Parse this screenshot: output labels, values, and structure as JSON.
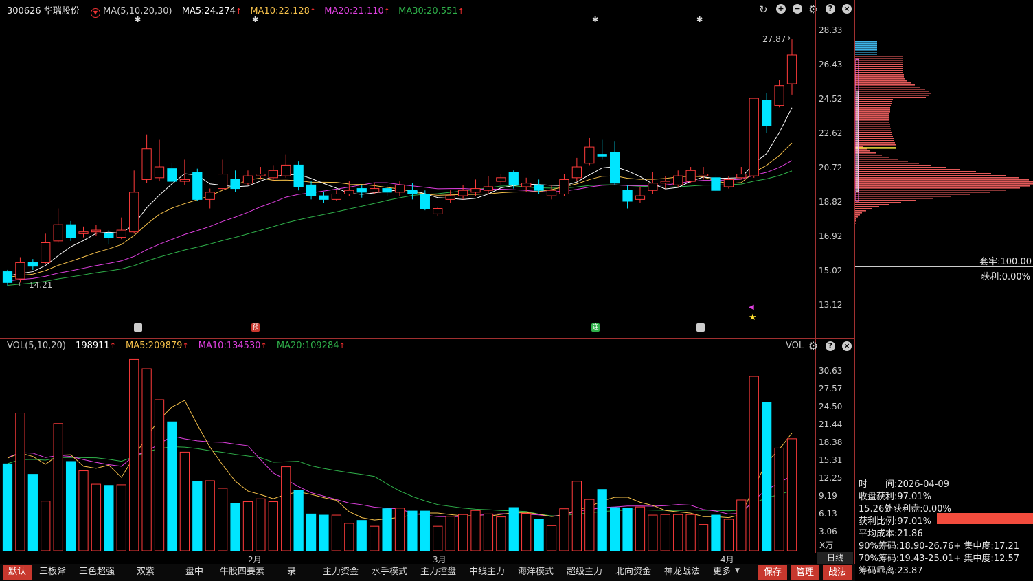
{
  "header": {
    "stock": "300626 华瑞股份",
    "ma_label": "MA(5,10,20,30)",
    "ma5": "MA5:24.274",
    "ma10": "MA10:22.128",
    "ma20": "MA20:21.110",
    "ma30": "MA30:20.551",
    "arrow": "↑"
  },
  "vol_header": {
    "label": "VOL(5,10,20)",
    "vol": "198911",
    "ma5": "MA5:209879",
    "ma10": "MA10:134530",
    "ma20": "MA20:109284",
    "right_label": "VOL",
    "arrow": "↑"
  },
  "price_axis": [
    "28.33",
    "26.43",
    "24.52",
    "22.62",
    "20.72",
    "18.82",
    "16.92",
    "15.02",
    "13.12"
  ],
  "vol_axis": [
    "30.63",
    "27.57",
    "24.50",
    "21.44",
    "18.38",
    "15.31",
    "12.25",
    "9.19",
    "6.13",
    "3.06"
  ],
  "vol_unit": "X万",
  "annotations": {
    "high": "27.87",
    "low": "14.21"
  },
  "x_labels": [
    "2月",
    "3月",
    "4月"
  ],
  "period": "日线",
  "chip_panel": {
    "trapped": "套牢:100.00",
    "profit": "获利:0.00%",
    "time": "时　　间:2026-04-09",
    "close_profit": "收盘获利:97.01%",
    "profit_at": "15.26处获利盘:0.00%",
    "profit_ratio": "获利比例:97.01%",
    "avg_cost": "平均成本:21.86",
    "chip90": "90%筹码:18.90-26.76+ 集中度:17.21",
    "chip70": "70%筹码:19.43-25.01+ 集中度:12.57",
    "deviation": "筹码乖离:23.87"
  },
  "toolbar": {
    "tabs": [
      "默认",
      "三板斧",
      "三色超强",
      "双紫",
      "盘中",
      "牛股四要素",
      "录",
      "主力资金",
      "水手模式",
      "主力控盘",
      "中线主力",
      "海洋模式",
      "超级主力",
      "北向资金",
      "神龙战法",
      "更多"
    ],
    "save": "保存",
    "manage": "管理",
    "battle": "战法"
  },
  "colors": {
    "up": "#ff3b3b",
    "down": "#00e5ff",
    "ma5": "#ffffff",
    "ma10": "#f5c04a",
    "ma20": "#e040e0",
    "ma30": "#2fb04a",
    "accent": "#c8382e"
  },
  "chart_data": {
    "type": "candlestick",
    "price_axis_range": [
      13.12,
      28.33
    ],
    "vol_axis_unit": "万",
    "candles": [
      {
        "o": 15.0,
        "c": 14.4,
        "h": 15.1,
        "l": 14.2
      },
      {
        "o": 14.6,
        "c": 15.5,
        "h": 15.8,
        "l": 14.4
      },
      {
        "o": 15.5,
        "c": 15.3,
        "h": 15.7,
        "l": 15.1
      },
      {
        "o": 15.5,
        "c": 16.6,
        "h": 17.1,
        "l": 15.4
      },
      {
        "o": 16.7,
        "c": 17.6,
        "h": 18.5,
        "l": 16.6
      },
      {
        "o": 17.6,
        "c": 16.9,
        "h": 17.8,
        "l": 16.7
      },
      {
        "o": 17.1,
        "c": 17.2,
        "h": 17.5,
        "l": 16.9
      },
      {
        "o": 17.2,
        "c": 17.3,
        "h": 17.6,
        "l": 17.0
      },
      {
        "o": 17.1,
        "c": 16.9,
        "h": 17.3,
        "l": 16.5
      },
      {
        "o": 16.9,
        "c": 17.3,
        "h": 18.0,
        "l": 16.8
      },
      {
        "o": 17.2,
        "c": 19.4,
        "h": 20.6,
        "l": 17.1
      },
      {
        "o": 20.1,
        "c": 21.8,
        "h": 22.6,
        "l": 19.9
      },
      {
        "o": 20.2,
        "c": 20.8,
        "h": 22.3,
        "l": 20.0
      },
      {
        "o": 20.7,
        "c": 20.0,
        "h": 21.0,
        "l": 19.6
      },
      {
        "o": 20.0,
        "c": 20.1,
        "h": 21.2,
        "l": 19.8
      },
      {
        "o": 20.5,
        "c": 19.0,
        "h": 20.7,
        "l": 18.9
      },
      {
        "o": 19.0,
        "c": 19.4,
        "h": 19.6,
        "l": 18.5
      },
      {
        "o": 19.6,
        "c": 20.4,
        "h": 21.2,
        "l": 19.5
      },
      {
        "o": 20.1,
        "c": 19.6,
        "h": 20.6,
        "l": 19.4
      },
      {
        "o": 19.9,
        "c": 20.3,
        "h": 20.6,
        "l": 19.8
      },
      {
        "o": 20.3,
        "c": 20.4,
        "h": 20.8,
        "l": 20.1
      },
      {
        "o": 20.2,
        "c": 20.6,
        "h": 20.9,
        "l": 20.0
      },
      {
        "o": 20.3,
        "c": 20.9,
        "h": 21.5,
        "l": 20.2
      },
      {
        "o": 20.9,
        "c": 19.7,
        "h": 21.1,
        "l": 19.5
      },
      {
        "o": 19.8,
        "c": 19.2,
        "h": 20.0,
        "l": 19.0
      },
      {
        "o": 19.2,
        "c": 19.0,
        "h": 19.4,
        "l": 18.8
      },
      {
        "o": 19.0,
        "c": 19.3,
        "h": 19.5,
        "l": 18.9
      },
      {
        "o": 19.3,
        "c": 19.5,
        "h": 20.0,
        "l": 19.2
      },
      {
        "o": 19.6,
        "c": 19.4,
        "h": 19.8,
        "l": 19.1
      },
      {
        "o": 19.4,
        "c": 19.6,
        "h": 19.9,
        "l": 19.3
      },
      {
        "o": 19.6,
        "c": 19.4,
        "h": 19.8,
        "l": 19.2
      },
      {
        "o": 19.4,
        "c": 19.8,
        "h": 20.0,
        "l": 19.2
      },
      {
        "o": 19.5,
        "c": 19.3,
        "h": 19.9,
        "l": 19.0
      },
      {
        "o": 19.3,
        "c": 18.5,
        "h": 19.5,
        "l": 18.4
      },
      {
        "o": 18.2,
        "c": 18.5,
        "h": 18.6,
        "l": 18.1
      },
      {
        "o": 19.0,
        "c": 19.2,
        "h": 19.5,
        "l": 18.8
      },
      {
        "o": 19.2,
        "c": 19.5,
        "h": 19.8,
        "l": 19.0
      },
      {
        "o": 19.4,
        "c": 19.6,
        "h": 20.1,
        "l": 19.2
      },
      {
        "o": 19.5,
        "c": 19.7,
        "h": 20.3,
        "l": 19.3
      },
      {
        "o": 20.0,
        "c": 20.2,
        "h": 20.4,
        "l": 19.8
      },
      {
        "o": 20.5,
        "c": 19.8,
        "h": 20.6,
        "l": 19.6
      },
      {
        "o": 19.7,
        "c": 19.9,
        "h": 20.2,
        "l": 19.4
      },
      {
        "o": 19.8,
        "c": 19.5,
        "h": 20.1,
        "l": 19.3
      },
      {
        "o": 19.2,
        "c": 19.5,
        "h": 19.8,
        "l": 19.0
      },
      {
        "o": 19.3,
        "c": 20.1,
        "h": 20.4,
        "l": 19.2
      },
      {
        "o": 20.2,
        "c": 20.8,
        "h": 21.3,
        "l": 20.0
      },
      {
        "o": 21.0,
        "c": 21.9,
        "h": 22.4,
        "l": 20.9
      },
      {
        "o": 21.5,
        "c": 21.4,
        "h": 22.3,
        "l": 21.2
      },
      {
        "o": 21.6,
        "c": 19.9,
        "h": 22.2,
        "l": 19.8
      },
      {
        "o": 19.5,
        "c": 18.9,
        "h": 19.8,
        "l": 18.5
      },
      {
        "o": 19.0,
        "c": 19.2,
        "h": 19.7,
        "l": 18.8
      },
      {
        "o": 19.5,
        "c": 19.9,
        "h": 20.5,
        "l": 19.3
      },
      {
        "o": 19.9,
        "c": 20.0,
        "h": 20.3,
        "l": 19.6
      },
      {
        "o": 19.8,
        "c": 20.3,
        "h": 20.6,
        "l": 19.7
      },
      {
        "o": 20.0,
        "c": 20.6,
        "h": 20.8,
        "l": 19.9
      },
      {
        "o": 20.3,
        "c": 20.4,
        "h": 20.8,
        "l": 20.1
      },
      {
        "o": 20.2,
        "c": 19.5,
        "h": 20.4,
        "l": 19.4
      },
      {
        "o": 19.7,
        "c": 20.1,
        "h": 20.3,
        "l": 19.6
      },
      {
        "o": 20.2,
        "c": 20.4,
        "h": 20.8,
        "l": 20.1
      },
      {
        "o": 20.3,
        "c": 24.6,
        "h": 24.6,
        "l": 20.2
      },
      {
        "o": 24.5,
        "c": 23.1,
        "h": 24.9,
        "l": 22.7
      },
      {
        "o": 24.2,
        "c": 25.3,
        "h": 25.6,
        "l": 24.1
      },
      {
        "o": 25.4,
        "c": 27.0,
        "h": 27.87,
        "l": 24.8
      }
    ],
    "volumes": [
      14.8,
      23.5,
      13.0,
      8.4,
      21.7,
      15.2,
      13.6,
      11.3,
      11.1,
      11.2,
      32.7,
      31.1,
      25.8,
      22.0,
      16.8,
      11.8,
      11.9,
      10.6,
      8.0,
      8.3,
      8.8,
      8.3,
      14.3,
      10.2,
      6.2,
      6.0,
      6.0,
      4.6,
      5.1,
      4.1,
      7.1,
      7.2,
      6.7,
      6.7,
      4.1,
      5.8,
      6.1,
      6.8,
      6.2,
      5.7,
      7.3,
      6.3,
      5.3,
      4.2,
      7.1,
      11.8,
      8.7,
      10.4,
      7.3,
      7.2,
      7.4,
      6.0,
      6.1,
      6.1,
      6.1,
      4.4,
      6.0,
      5.3,
      8.6,
      29.8,
      25.3,
      17.5,
      19.1
    ],
    "ma_series": [
      "MA5",
      "MA10",
      "MA20",
      "MA30"
    ]
  }
}
